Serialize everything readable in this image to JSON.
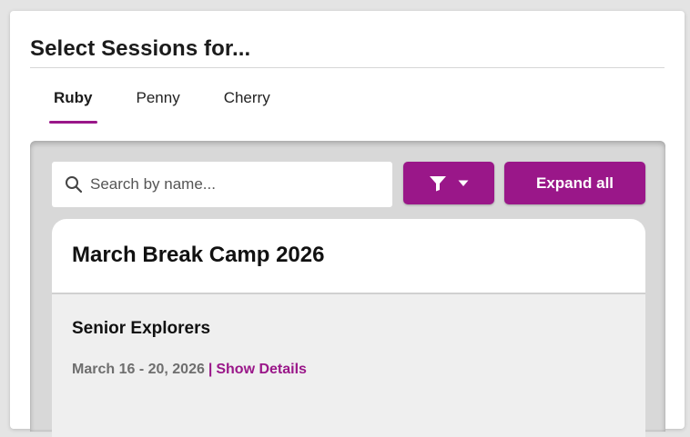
{
  "header": {
    "title": "Select Sessions for..."
  },
  "tabs": [
    {
      "label": "Ruby",
      "active": true
    },
    {
      "label": "Penny",
      "active": false
    },
    {
      "label": "Cherry",
      "active": false
    }
  ],
  "toolbar": {
    "search_placeholder": "Search by name...",
    "filter_icon": "filter-icon",
    "dropdown_icon": "caret-down-icon",
    "expand_all_label": "Expand all"
  },
  "camp": {
    "title": "March Break Camp 2026",
    "session": {
      "name": "Senior Explorers",
      "dates": "March 16 - 20, 2026",
      "separator": "|",
      "details_link": "Show Details"
    }
  },
  "colors": {
    "accent": "#9a1789",
    "panel_bg": "#d8d8d8",
    "session_bg": "#efefef"
  }
}
